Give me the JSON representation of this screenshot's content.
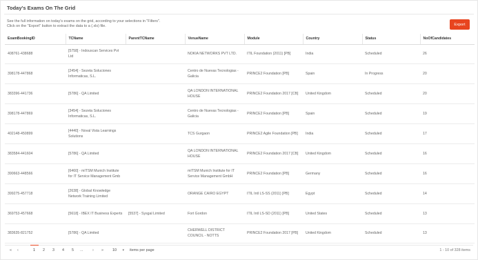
{
  "panel": {
    "title": "Today's Exams On The Grid",
    "desc_line1": "See the full information on today's exams on the grid, according to your selections in \"Filters\".",
    "desc_line2": "Click on the \"Export\" button to extract the data to a (.xls) file.",
    "export_label": "Export"
  },
  "table": {
    "columns": [
      "ExamBookingID",
      "TCName",
      "ParentTCName",
      "VenueName",
      "Module",
      "Country",
      "Status",
      "NoOfCandidates"
    ],
    "rows": [
      [
        "408761-438688",
        "[5758] - Indouscan Services Pvt Ltd",
        "",
        "NOKIA NETWORKS PVT LTD.",
        "ITIL Foundation (2011) [PB]",
        "India",
        "Scheduled",
        "26"
      ],
      [
        "398178-447868",
        "[2454] - Sezeta Soluciones Informaticas, S.L.",
        "",
        "Centro de Nuevas Tecnologias - Galicia",
        "PRINCE2 Foundation [PB]",
        "Spain",
        "In Progress",
        "20"
      ],
      [
        "383396-441736",
        "[5786] - QA Limited",
        "",
        "QA LONDON INTERNATIONAL HOUSE",
        "PRINCE2 Foundation 2017 [CB]",
        "United Kingdom",
        "Scheduled",
        "20"
      ],
      [
        "398178-447869",
        "[3454] - Sezeta Soluciones Informaticas, S.L.",
        "",
        "Centro de Nuevas Tecnologias - Galicia",
        "PRINCE2 Foundation [PB]",
        "Spain",
        "Scheduled",
        "19"
      ],
      [
        "402148-450899",
        "[4440] - Noval Vista Learnings Solutions",
        "",
        "TCS Gurgaon",
        "PRINCE2 Agile Foundation [PB]",
        "India",
        "Scheduled",
        "17"
      ],
      [
        "383584-441604",
        "[5786] - QA Limited",
        "",
        "QA LONDON INTERNATIONAL HOUSE",
        "PRINCE2 Foundation 2017 [CB]",
        "United Kingdom",
        "Scheduled",
        "16"
      ],
      [
        "390663-448566",
        "[6460] - mITSM Munich Institute for IT Service Management Gmb",
        "",
        "mITSM Munich Institute for IT Service Management GmbH",
        "PRINCE2 Foundation [PB]",
        "Germany",
        "Scheduled",
        "16"
      ],
      [
        "399275-457718",
        "[2638] - Global Knowledge Network Training Limited",
        "",
        "ORANGE CAIRO EGYPT",
        "ITIL Intl LS-SS (2011) [PB]",
        "Egypt",
        "Scheduled",
        "14"
      ],
      [
        "369753-457668",
        "[5618] - IBEX IT Business Experts",
        "[5537] - Sysgal Limited",
        "Fort Gordon",
        "ITIL Intl LS-SD (2011) [PB]",
        "United States",
        "Scheduled",
        "13"
      ],
      [
        "383635-821752",
        "[5786] - QA Limited",
        "",
        "CHERWELL DISTRICT COUNCIL - NOTTS",
        "PRINCE2 Foundation 2017 [PB]",
        "United Kingdom",
        "Scheduled",
        "13"
      ]
    ]
  },
  "pager": {
    "first": "«",
    "prev": "‹",
    "pages": [
      "1",
      "2",
      "3",
      "4",
      "5",
      "..."
    ],
    "next": "›",
    "last": "»",
    "page_size": "10",
    "items_label": "items per page",
    "summary": "1 - 10 of 328 items",
    "accent_color": "#e8451f"
  },
  "colors": {
    "accent": "#e8451f",
    "border": "#e6e6e6"
  }
}
